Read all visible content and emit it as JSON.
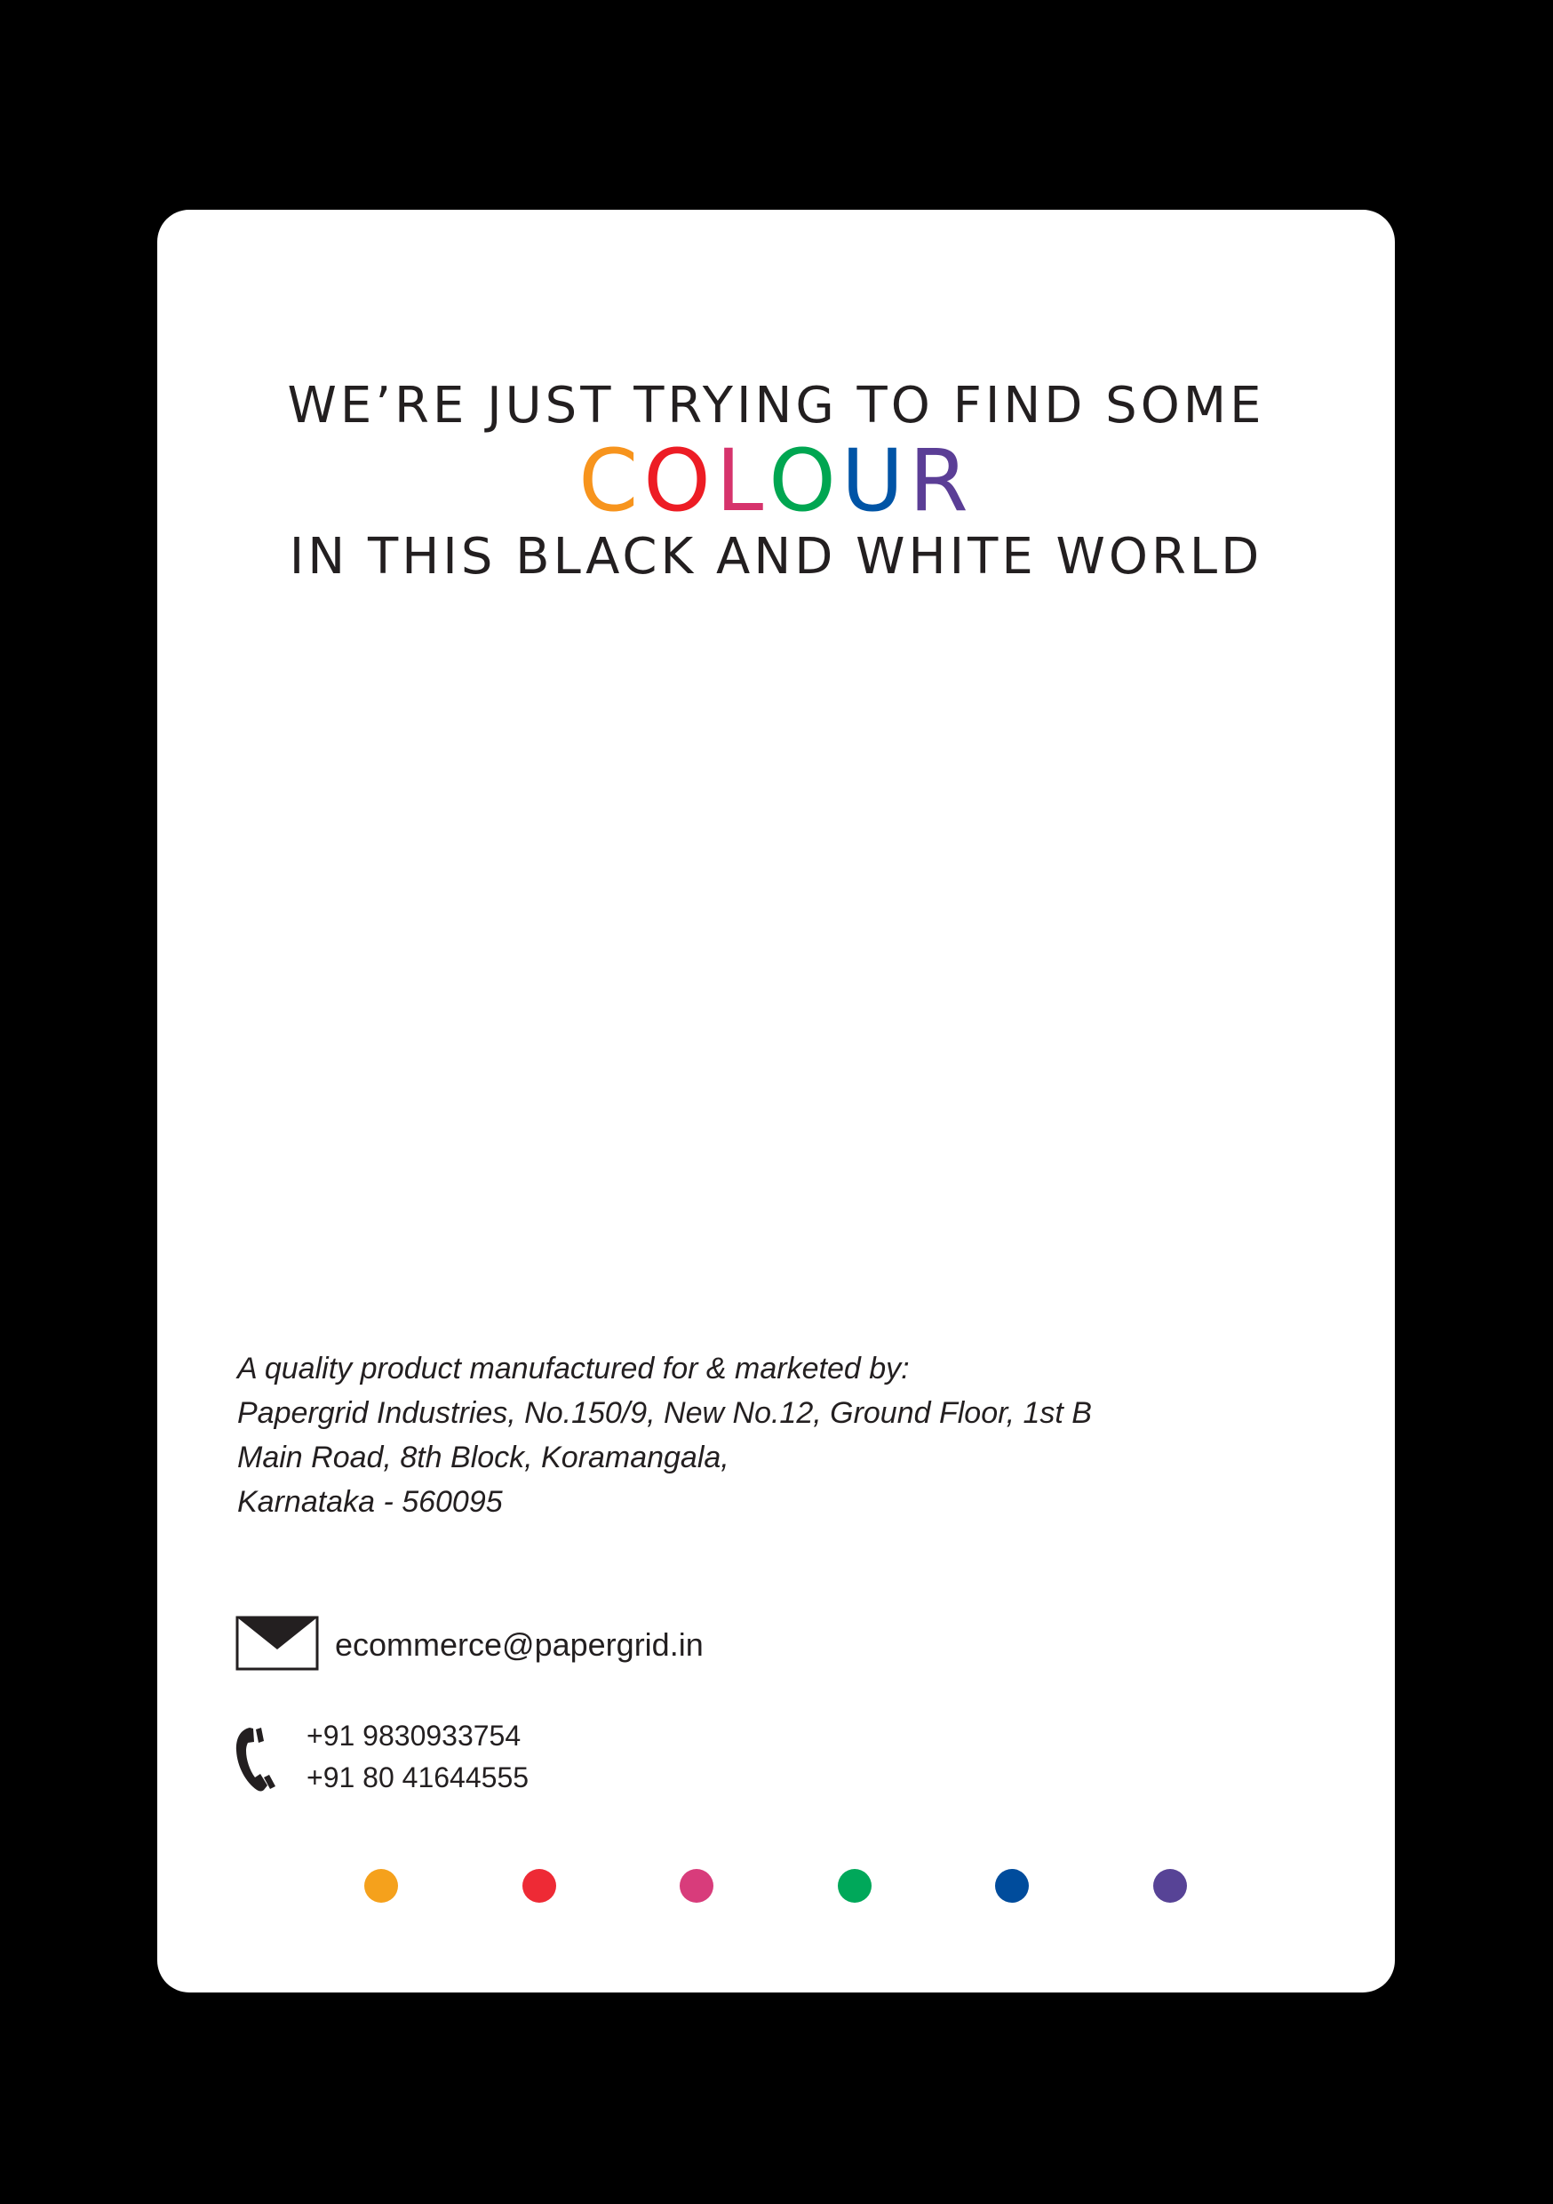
{
  "tagline": {
    "line1": "WE’RE JUST TRYING TO FIND SOME",
    "colour_letters": [
      {
        "char": "C",
        "color": "#f7941d"
      },
      {
        "char": "O",
        "color": "#ed1c24"
      },
      {
        "char": "L",
        "color": "#d6336c"
      },
      {
        "char": "O",
        "color": "#00a651"
      },
      {
        "char": "U",
        "color": "#0054a6"
      },
      {
        "char": "R",
        "color": "#5b3e96"
      }
    ],
    "line3": "IN THIS BLACK AND WHITE WORLD"
  },
  "address": {
    "lines": [
      "A quality product manufactured for & marketed by:",
      "Papergrid Industries, No.150/9, New No.12, Ground Floor, 1st B",
      "Main Road, 8th Block, Koramangala,",
      "Karnataka - 560095"
    ]
  },
  "contact": {
    "email_icon": "envelope-icon",
    "email": "ecommerce@papergrid.in",
    "phone_icon": "phone-icon",
    "phones": [
      "+91 9830933754",
      "+91 80 41644555"
    ]
  },
  "dots": {
    "colors": [
      "#f5a11c",
      "#ee2a35",
      "#d83c7b",
      "#00a85a",
      "#004c9c",
      "#574396"
    ]
  },
  "colors": {
    "background": "#000000",
    "card": "#ffffff",
    "text": "#231f20"
  }
}
